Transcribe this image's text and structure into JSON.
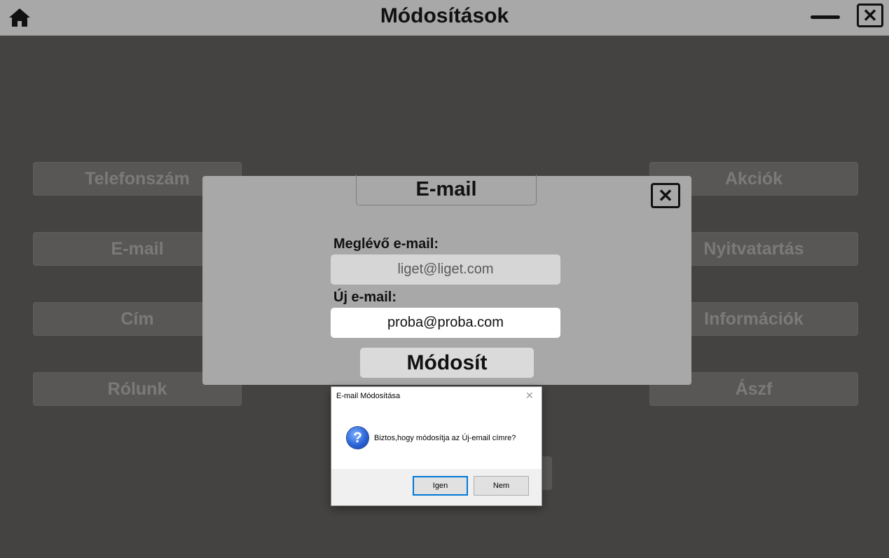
{
  "window": {
    "title": "Módosítások"
  },
  "menu_left": [
    "Telefonszám",
    "E-mail",
    "Cím",
    "Rólunk"
  ],
  "menu_right": [
    "Akciók",
    "Nyitvatartás",
    "Információk",
    "Ászf"
  ],
  "email_panel": {
    "title": "E-mail",
    "existing_label": "Meglévő e-mail:",
    "existing_value": "liget@liget.com",
    "new_label": "Új e-mail:",
    "new_value": "proba@proba.com",
    "submit_label": "Módosít"
  },
  "confirm_dialog": {
    "title": "E-mail Módosítása",
    "message": "Biztos,hogy módosítja az Új-email címre?",
    "yes_label": "Igen",
    "no_label": "Nem"
  },
  "icons": {
    "home": "home-icon",
    "minimize": "minimize-icon",
    "close": "close-icon",
    "question": "question-icon"
  },
  "colors": {
    "background": "#444341",
    "titlebar": "#a8a8a8",
    "panel": "#a8a8a8",
    "dialog_accent": "#0078d7"
  }
}
